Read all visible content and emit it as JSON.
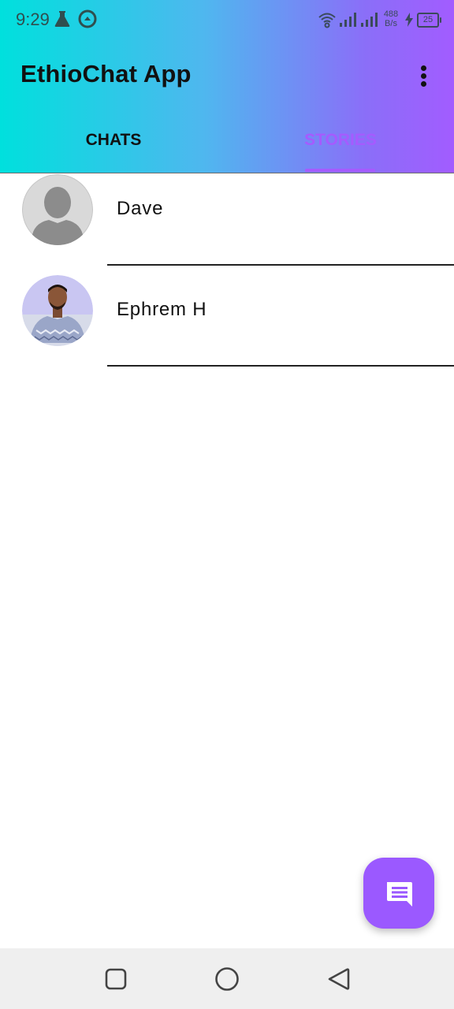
{
  "status_bar": {
    "time": "9:29",
    "net_speed_value": "488",
    "net_speed_unit": "B/s",
    "battery": "25",
    "icons": [
      "flask-icon",
      "sync-icon",
      "wifi-icon",
      "signal-icon",
      "signal-icon",
      "charging-icon",
      "battery-icon"
    ]
  },
  "app_bar": {
    "title": "EthioChat App",
    "menu_icon": "more-vert-icon"
  },
  "tabs": [
    {
      "label": "CHATS",
      "selected": false
    },
    {
      "label": "STORIES",
      "selected": true
    }
  ],
  "chats": [
    {
      "name": "Dave",
      "avatar": "default-person-avatar"
    },
    {
      "name": "Ephrem H",
      "avatar": "profile-photo"
    }
  ],
  "fab": {
    "icon": "message-icon"
  },
  "nav_bar": {
    "buttons": [
      "recents-square-icon",
      "home-circle-icon",
      "back-triangle-icon"
    ]
  },
  "colors": {
    "gradient_start": "#00e0dd",
    "gradient_end": "#a25cff",
    "accent": "#a55bff",
    "fab": "#9b59ff"
  }
}
